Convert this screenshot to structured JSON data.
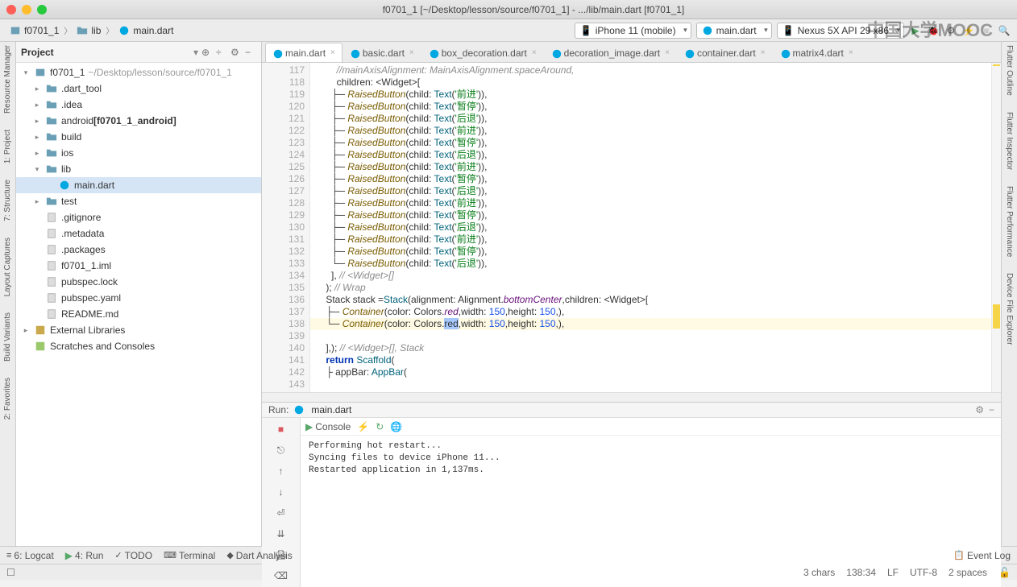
{
  "window": {
    "title": "f0701_1 [~/Desktop/lesson/source/f0701_1] - .../lib/main.dart [f0701_1]"
  },
  "breadcrumb": {
    "project": "f0701_1",
    "folder": "lib",
    "file": "main.dart"
  },
  "toolbar": {
    "device": "iPhone 11 (mobile)",
    "config": "main.dart",
    "emulator": "Nexus 5X API 29 x86"
  },
  "watermark": "中国大学MOOC",
  "left_rail": [
    "Resource Manager",
    "1: Project",
    "7: Structure",
    "Layout Captures",
    "Build Variants",
    "2: Favorites"
  ],
  "right_rail": [
    "Flutter Outline",
    "Flutter Inspector",
    "Flutter Performance",
    "Device File Explorer"
  ],
  "project_panel": {
    "header": "Project",
    "tree": [
      {
        "lvl": 0,
        "arr": "▾",
        "ico": "proj",
        "label": "f0701_1",
        "dim": "~/Desktop/lesson/source/f0701_1"
      },
      {
        "lvl": 1,
        "arr": "▸",
        "ico": "folder",
        "label": ".dart_tool"
      },
      {
        "lvl": 1,
        "arr": "▸",
        "ico": "folder",
        "label": ".idea"
      },
      {
        "lvl": 1,
        "arr": "▸",
        "ico": "folder",
        "label": "android",
        "bold": "[f0701_1_android]"
      },
      {
        "lvl": 1,
        "arr": "▸",
        "ico": "folder",
        "label": "build"
      },
      {
        "lvl": 1,
        "arr": "▸",
        "ico": "folder",
        "label": "ios"
      },
      {
        "lvl": 1,
        "arr": "▾",
        "ico": "folder",
        "label": "lib"
      },
      {
        "lvl": 2,
        "arr": "",
        "ico": "dart",
        "label": "main.dart",
        "sel": true
      },
      {
        "lvl": 1,
        "arr": "▸",
        "ico": "folder",
        "label": "test"
      },
      {
        "lvl": 1,
        "arr": "",
        "ico": "file",
        "label": ".gitignore"
      },
      {
        "lvl": 1,
        "arr": "",
        "ico": "file",
        "label": ".metadata"
      },
      {
        "lvl": 1,
        "arr": "",
        "ico": "file",
        "label": ".packages"
      },
      {
        "lvl": 1,
        "arr": "",
        "ico": "file",
        "label": "f0701_1.iml"
      },
      {
        "lvl": 1,
        "arr": "",
        "ico": "file",
        "label": "pubspec.lock"
      },
      {
        "lvl": 1,
        "arr": "",
        "ico": "file",
        "label": "pubspec.yaml"
      },
      {
        "lvl": 1,
        "arr": "",
        "ico": "file",
        "label": "README.md"
      },
      {
        "lvl": 0,
        "arr": "▸",
        "ico": "lib",
        "label": "External Libraries"
      },
      {
        "lvl": 0,
        "arr": "",
        "ico": "scratch",
        "label": "Scratches and Consoles"
      }
    ]
  },
  "editor_tabs": [
    {
      "label": "main.dart",
      "active": true
    },
    {
      "label": "basic.dart"
    },
    {
      "label": "box_decoration.dart"
    },
    {
      "label": "decoration_image.dart"
    },
    {
      "label": "container.dart"
    },
    {
      "label": "matrix4.dart"
    }
  ],
  "code": {
    "first_line": 117,
    "lines": [
      {
        "n": 117,
        "html": "        <span class='c-cmt'>//mainAxisAlignment: MainAxisAlignment.spaceAround,</span>"
      },
      {
        "n": 118,
        "html": "        children: &lt;Widget&gt;["
      },
      {
        "n": 119,
        "html": "      ├─ <span class='c-cls'>RaisedButton</span>(child: <span class='c-fn'>Text</span>(<span class='c-str'>'前进'</span>)),"
      },
      {
        "n": 120,
        "html": "      ├─ <span class='c-cls'>RaisedButton</span>(child: <span class='c-fn'>Text</span>(<span class='c-str'>'暂停'</span>)),"
      },
      {
        "n": 121,
        "html": "      ├─ <span class='c-cls'>RaisedButton</span>(child: <span class='c-fn'>Text</span>(<span class='c-str'>'后退'</span>)),"
      },
      {
        "n": 122,
        "html": "      ├─ <span class='c-cls'>RaisedButton</span>(child: <span class='c-fn'>Text</span>(<span class='c-str'>'前进'</span>)),"
      },
      {
        "n": 123,
        "html": "      ├─ <span class='c-cls'>RaisedButton</span>(child: <span class='c-fn'>Text</span>(<span class='c-str'>'暂停'</span>)),"
      },
      {
        "n": 124,
        "html": "      ├─ <span class='c-cls'>RaisedButton</span>(child: <span class='c-fn'>Text</span>(<span class='c-str'>'后退'</span>)),"
      },
      {
        "n": 125,
        "html": "      ├─ <span class='c-cls'>RaisedButton</span>(child: <span class='c-fn'>Text</span>(<span class='c-str'>'前进'</span>)),"
      },
      {
        "n": 126,
        "html": "      ├─ <span class='c-cls'>RaisedButton</span>(child: <span class='c-fn'>Text</span>(<span class='c-str'>'暂停'</span>)),"
      },
      {
        "n": 127,
        "html": "      ├─ <span class='c-cls'>RaisedButton</span>(child: <span class='c-fn'>Text</span>(<span class='c-str'>'后退'</span>)),"
      },
      {
        "n": 128,
        "html": "      ├─ <span class='c-cls'>RaisedButton</span>(child: <span class='c-fn'>Text</span>(<span class='c-str'>'前进'</span>)),"
      },
      {
        "n": 129,
        "html": "      ├─ <span class='c-cls'>RaisedButton</span>(child: <span class='c-fn'>Text</span>(<span class='c-str'>'暂停'</span>)),"
      },
      {
        "n": 130,
        "html": "      ├─ <span class='c-cls'>RaisedButton</span>(child: <span class='c-fn'>Text</span>(<span class='c-str'>'后退'</span>)),"
      },
      {
        "n": 131,
        "html": "      ├─ <span class='c-cls'>RaisedButton</span>(child: <span class='c-fn'>Text</span>(<span class='c-str'>'前进'</span>)),"
      },
      {
        "n": 132,
        "html": "      ├─ <span class='c-cls'>RaisedButton</span>(child: <span class='c-fn'>Text</span>(<span class='c-str'>'暂停'</span>)),"
      },
      {
        "n": 133,
        "html": "      └─ <span class='c-cls'>RaisedButton</span>(child: <span class='c-fn'>Text</span>(<span class='c-str'>'后退'</span>)),"
      },
      {
        "n": 134,
        "html": "      ], <span class='c-cmt'>// &lt;Widget&gt;[]</span>"
      },
      {
        "n": 135,
        "html": "    ); <span class='c-cmt'>// Wrap</span>"
      },
      {
        "n": 136,
        "html": "    Stack stack =<span class='c-fn'>Stack</span>(alignment: Alignment.<span class='c-id'>bottomCenter</span>,children: &lt;Widget&gt;["
      },
      {
        "n": 137,
        "bp": true,
        "html": "    ├─ <span class='c-cls'>Container</span>(color: Colors.<span class='c-id'>red</span>,width: <span class='c-num'>150</span>,height: <span class='c-num'>150</span>,),"
      },
      {
        "n": 138,
        "bp": true,
        "hl": true,
        "html": "    └─ <span class='c-cls'>Container</span>(color: Colors.<span class='c-sel'>red</span>,width: <span class='c-num'>150</span>,height: <span class='c-num'>150</span>,),"
      },
      {
        "n": 139,
        "html": ""
      },
      {
        "n": 140,
        "html": "    ],); <span class='c-cmt'>// &lt;Widget&gt;[], Stack</span>"
      },
      {
        "n": 141,
        "html": "    <span class='c-kw'>return</span> <span class='c-fn'>Scaffold</span>("
      },
      {
        "n": 142,
        "html": "    ├ appBar: <span class='c-fn'>AppBar</span>("
      },
      {
        "n": 143,
        "html": ""
      }
    ]
  },
  "run": {
    "label": "Run:",
    "file": "main.dart",
    "console_tab": "Console",
    "output": "Performing hot restart...\nSyncing files to device iPhone 11...\nRestarted application in 1,137ms."
  },
  "bottom_tabs": {
    "logcat": "6: Logcat",
    "run": "4: Run",
    "todo": "TODO",
    "terminal": "Terminal",
    "dart": "Dart Analysis",
    "event": "Event Log"
  },
  "status": {
    "chars": "3 chars",
    "pos": "138:34",
    "le": "LF",
    "enc": "UTF-8",
    "indent": "2 spaces"
  }
}
